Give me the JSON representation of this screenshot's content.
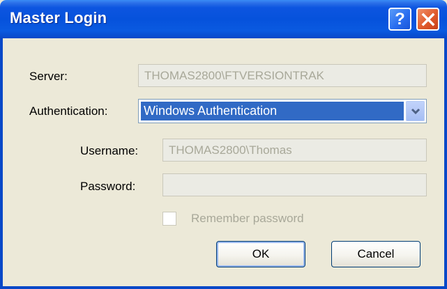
{
  "window": {
    "title": "Master Login",
    "help_glyph": "?",
    "close_glyph": "X"
  },
  "server": {
    "label": "Server:",
    "value": "THOMAS2800\\FTVERSIONTRAK"
  },
  "authentication": {
    "label": "Authentication:",
    "selected": "Windows Authentication"
  },
  "username": {
    "label": "Username:",
    "value": "THOMAS2800\\Thomas"
  },
  "password": {
    "label": "Password:",
    "value": ""
  },
  "remember": {
    "label": "Remember password",
    "checked": false,
    "enabled": false
  },
  "buttons": {
    "ok": "OK",
    "cancel": "Cancel"
  },
  "icons": [
    "help-icon",
    "close-icon",
    "chevron-down-icon"
  ],
  "colors": {
    "titlebar": "#0652dc",
    "dialog_bg": "#ece9d8",
    "selection": "#316ac5",
    "disabled_text": "#a8a899"
  }
}
